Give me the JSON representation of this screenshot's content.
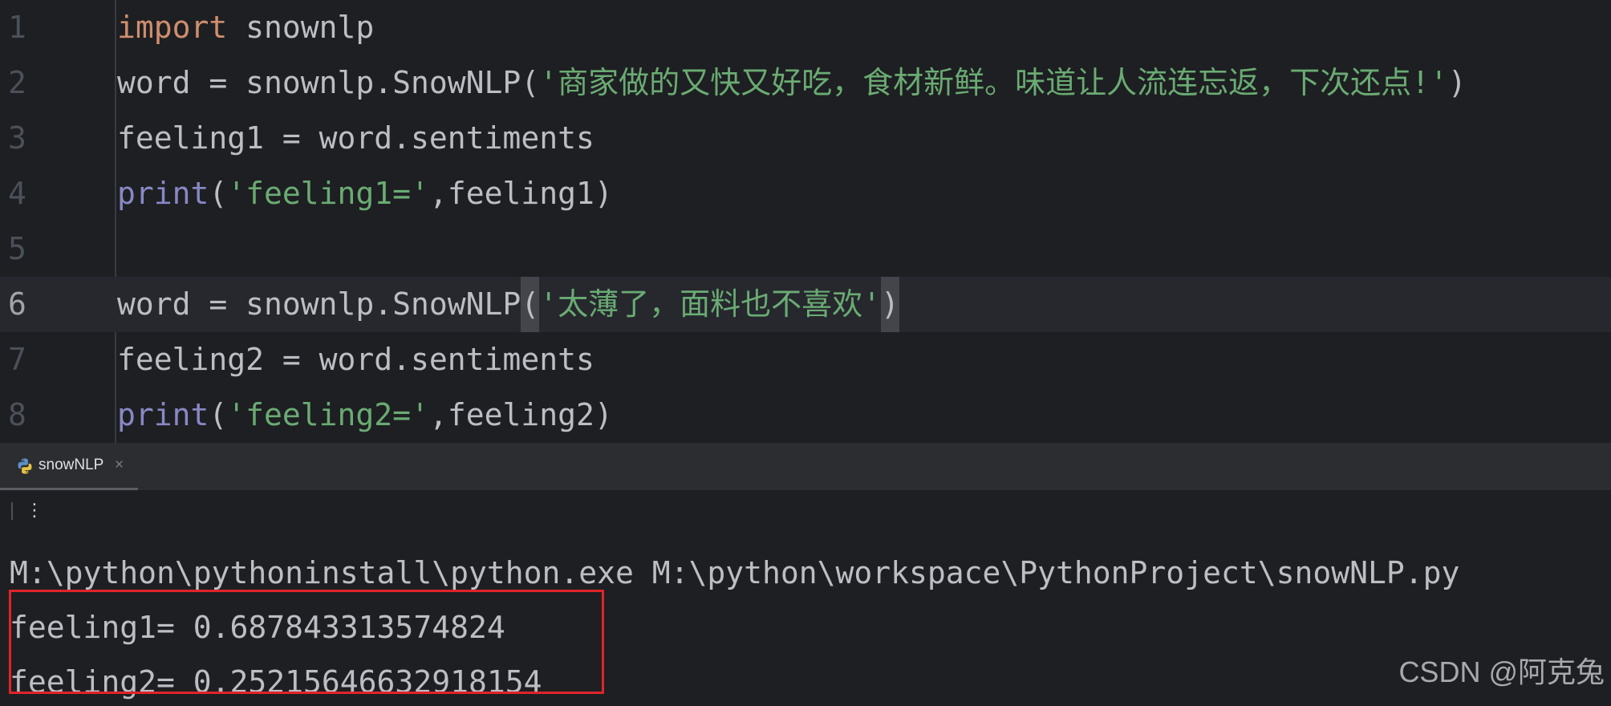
{
  "editor": {
    "lines": [
      {
        "num": "1",
        "tokens": [
          {
            "t": "kw",
            "v": "import"
          },
          {
            "t": "plain",
            "v": " snownlp"
          }
        ]
      },
      {
        "num": "2",
        "tokens": [
          {
            "t": "plain",
            "v": "word = snownlp.SnowNLP("
          },
          {
            "t": "str",
            "v": "'商家做的又快又好吃，食材新鲜。味道让人流连忘返，下次还点!'"
          },
          {
            "t": "plain",
            "v": ")"
          }
        ]
      },
      {
        "num": "3",
        "tokens": [
          {
            "t": "plain",
            "v": "feeling1 = word.sentiments"
          }
        ]
      },
      {
        "num": "4",
        "tokens": [
          {
            "t": "fn",
            "v": "print"
          },
          {
            "t": "plain",
            "v": "("
          },
          {
            "t": "str",
            "v": "'feeling1='"
          },
          {
            "t": "plain",
            "v": ",feeling1)"
          }
        ]
      },
      {
        "num": "5",
        "tokens": []
      },
      {
        "num": "6",
        "current": true,
        "tokens": [
          {
            "t": "plain",
            "v": "word = snownlp.SnowNLP"
          },
          {
            "t": "plain",
            "v": "(",
            "match": true
          },
          {
            "t": "str",
            "v": "'太薄了，面料也不喜欢'"
          },
          {
            "t": "caret",
            "v": ""
          },
          {
            "t": "plain",
            "v": ")",
            "match": true
          }
        ]
      },
      {
        "num": "7",
        "tokens": [
          {
            "t": "plain",
            "v": "feeling2 = word.sentiments"
          }
        ]
      },
      {
        "num": "8",
        "tokens": [
          {
            "t": "fn",
            "v": "print"
          },
          {
            "t": "plain",
            "v": "("
          },
          {
            "t": "str",
            "v": "'feeling2='"
          },
          {
            "t": "plain",
            "v": ",feeling2)"
          }
        ]
      }
    ]
  },
  "run_panel": {
    "tab_label": "snowNLP",
    "tab_close": "×",
    "more_icon": "⋮"
  },
  "console": {
    "lines": [
      "M:\\python\\pythoninstall\\python.exe M:\\python\\workspace\\PythonProject\\snowNLP.py",
      "feeling1= 0.687843313574824",
      "feeling2= 0.2521564663291815​4"
    ]
  },
  "watermark": "CSDN @阿克兔",
  "colors": {
    "keyword": "#cf8e6d",
    "builtin": "#8888c6",
    "string": "#6aab73",
    "text": "#bcbec4",
    "highlight_box": "#e0242a"
  }
}
